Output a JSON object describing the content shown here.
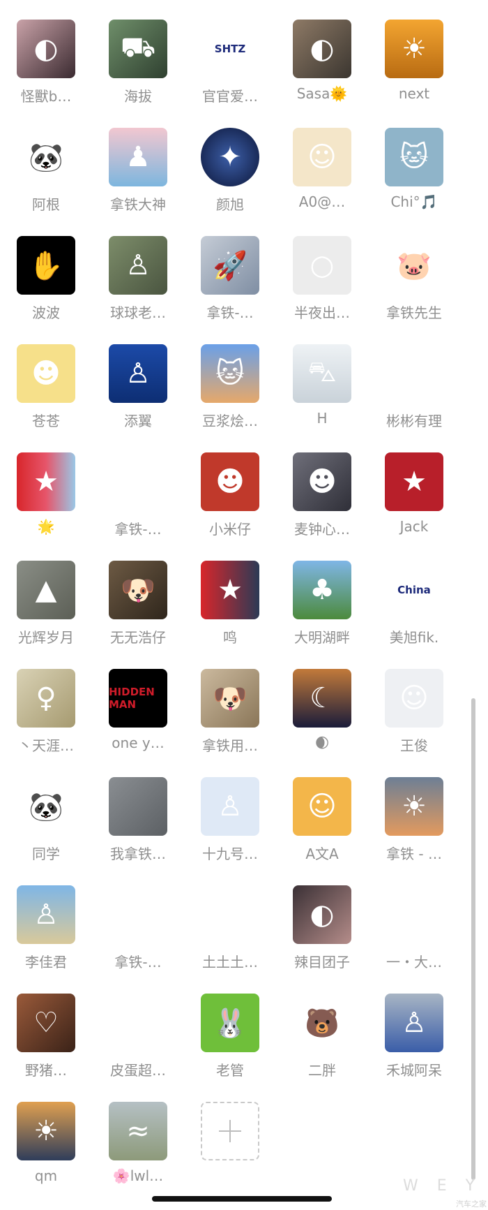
{
  "members": [
    {
      "name": "怪獸b…",
      "icon": "photo-woman-icon",
      "bg": "linear-gradient(135deg,#c9a2a8,#3a2a30)",
      "glyph": "◐"
    },
    {
      "name": "海拔",
      "icon": "photo-car-icon",
      "bg": "linear-gradient(135deg,#6f8f6a,#2f4030)",
      "glyph": "⛟"
    },
    {
      "name": "官官爱…",
      "icon": "shtz-logo-icon",
      "bg": "#ffffff",
      "glyph": "SHTZ"
    },
    {
      "name": "Sasa🌞",
      "icon": "photo-woman-car-icon",
      "bg": "linear-gradient(135deg,#8e7a66,#3b3630)",
      "glyph": "◐"
    },
    {
      "name": "next",
      "icon": "sunset-field-icon",
      "bg": "linear-gradient(180deg,#f3a531,#b86b12)",
      "glyph": "☀"
    },
    {
      "name": "阿根",
      "icon": "panda-icon",
      "bg": "#ffffff",
      "glyph": "🐼"
    },
    {
      "name": "拿铁大神",
      "icon": "swing-silhouette-icon",
      "bg": "linear-gradient(180deg,#f2c7d0,#7db6de)",
      "glyph": "♟"
    },
    {
      "name": "颜旭",
      "icon": "earth-angel-icon",
      "bg": "radial-gradient(circle,#3d5fa8,#0b1538)",
      "glyph": "✦",
      "round": true
    },
    {
      "name": "A0@…",
      "icon": "cartoon-girl-icon",
      "bg": "#f4e6c9",
      "glyph": "☺"
    },
    {
      "name": "Chi°🎵",
      "icon": "tom-cat-icon",
      "bg": "#8fb4c9",
      "glyph": "🐱"
    },
    {
      "name": "波波",
      "icon": "hand-heart-icon",
      "bg": "#000000",
      "glyph": "✋"
    },
    {
      "name": "球球老…",
      "icon": "photo-family-icon",
      "bg": "linear-gradient(135deg,#7d8d6a,#4a5540)",
      "glyph": "♙"
    },
    {
      "name": "拿铁-…",
      "icon": "rocket-icon",
      "bg": "linear-gradient(135deg,#c5ccd6,#7f8ea3)",
      "glyph": "🚀"
    },
    {
      "name": "半夜出…",
      "icon": "whistle-icon",
      "bg": "#ececec",
      "glyph": "○"
    },
    {
      "name": "拿铁先生",
      "icon": "pig-icon",
      "bg": "#ffffff",
      "glyph": "🐷"
    },
    {
      "name": "苍苍",
      "icon": "crayon-shinchan-icon",
      "bg": "#f6e08a",
      "glyph": "☻"
    },
    {
      "name": "添翼",
      "icon": "photo-man-suit-icon",
      "bg": "linear-gradient(180deg,#1c4aa8,#0d2e73)",
      "glyph": "♙"
    },
    {
      "name": "豆浆烩…",
      "icon": "cat-photo-icon",
      "bg": "linear-gradient(180deg,#6aa0e8,#e6a86a)",
      "glyph": "🐱"
    },
    {
      "name": "H",
      "icon": "robot-cars-icon",
      "bg": "linear-gradient(180deg,#eef2f5,#c9d2d9)",
      "glyph": "⛍"
    },
    {
      "name": "彬彬有理",
      "icon": "blank-avatar-icon",
      "bg": "#ffffff",
      "glyph": ""
    },
    {
      "name": "🌟",
      "icon": "flag-anniversary-icon",
      "bg": "linear-gradient(90deg,#d8262b,#e6556a,#9ac7e6)",
      "glyph": "★"
    },
    {
      "name": "拿铁-…",
      "icon": "purple-bunny-icon",
      "bg": "#ffffff",
      "glyph": "😈"
    },
    {
      "name": "小米仔",
      "icon": "luffy-icon",
      "bg": "#c0392b",
      "glyph": "☻"
    },
    {
      "name": "麦钟心…",
      "icon": "photo-man-mask-icon",
      "bg": "linear-gradient(135deg,#6f6f7a,#2f2f38)",
      "glyph": "☻"
    },
    {
      "name": "Jack",
      "icon": "nezha-flag-icon",
      "bg": "#b81f2a",
      "glyph": "★"
    },
    {
      "name": "光辉岁月",
      "icon": "photo-rock-icon",
      "bg": "linear-gradient(135deg,#8a8e86,#5c5f56)",
      "glyph": "▲"
    },
    {
      "name": "无无浩仔",
      "icon": "white-dog-icon",
      "bg": "linear-gradient(135deg,#6d5a44,#2f261c)",
      "glyph": "🐶"
    },
    {
      "name": "鸣",
      "icon": "flag-anime-boy-icon",
      "bg": "linear-gradient(90deg,#d8262b,#2c3a55)",
      "glyph": "★"
    },
    {
      "name": "大明湖畔",
      "icon": "palm-tree-icon",
      "bg": "linear-gradient(180deg,#7fb6e6,#4c8a3c)",
      "glyph": "♣"
    },
    {
      "name": "美旭fik.",
      "icon": "china-eye-icon",
      "bg": "#ffffff",
      "glyph": "China"
    },
    {
      "name": "丶天涯…",
      "icon": "photo-twins-icon",
      "bg": "linear-gradient(135deg,#d9d2b5,#a69a70)",
      "glyph": "♀"
    },
    {
      "name": "one y…",
      "icon": "hidden-man-icon",
      "bg": "#000000",
      "glyph": "HIDDEN MAN"
    },
    {
      "name": "拿铁用…",
      "icon": "dog-photo-icon",
      "bg": "linear-gradient(135deg,#cbb99e,#8a7658)",
      "glyph": "🐶"
    },
    {
      "name": "🌒",
      "icon": "dusk-silhouette-icon",
      "bg": "linear-gradient(180deg,#c27a3a,#1a1c3a)",
      "glyph": "☾"
    },
    {
      "name": "王俊",
      "icon": "cartoon-boy-icon",
      "bg": "#eef0f3",
      "glyph": "☺"
    },
    {
      "name": "同学",
      "icon": "panda-small-icon",
      "bg": "#ffffff",
      "glyph": "🐼"
    },
    {
      "name": "我拿铁…",
      "icon": "gray-photo-icon",
      "bg": "linear-gradient(135deg,#8a8e92,#5c6064)",
      "glyph": ""
    },
    {
      "name": "十九号…",
      "icon": "police-cartoon-icon",
      "bg": "#dfe9f6",
      "glyph": "♙"
    },
    {
      "name": "A文A",
      "icon": "monk-cartoon-icon",
      "bg": "#f3b64a",
      "glyph": "☺"
    },
    {
      "name": "拿铁 - …",
      "icon": "sunset-sky-icon",
      "bg": "linear-gradient(180deg,#6d7f95,#e39a5e)",
      "glyph": "☀"
    },
    {
      "name": "李佳君",
      "icon": "photo-family-beach-icon",
      "bg": "linear-gradient(180deg,#7fb6e6,#d9c99a)",
      "glyph": "♙"
    },
    {
      "name": "拿铁-…",
      "icon": "heart-sketch-icon",
      "bg": "#ffffff",
      "glyph": "♥"
    },
    {
      "name": "土土土…",
      "icon": "heart-sketch-icon",
      "bg": "#ffffff",
      "glyph": "♥"
    },
    {
      "name": "辣目团子",
      "icon": "photo-woman-portrait-icon",
      "bg": "linear-gradient(135deg,#3a3035,#b58d8a)",
      "glyph": "◐"
    },
    {
      "name": "一・大…",
      "icon": "cartoon-sitting-icon",
      "bg": "#ffffff",
      "glyph": "☺"
    },
    {
      "name": "野猪…",
      "icon": "hands-heart-icon",
      "bg": "linear-gradient(135deg,#9a5a3a,#3a2218)",
      "glyph": "♡"
    },
    {
      "name": "皮蛋超…",
      "icon": "baby-photo-icon",
      "bg": "#ffffff",
      "glyph": "☺"
    },
    {
      "name": "老管",
      "icon": "bunny-glasses-icon",
      "bg": "#6fbf3a",
      "glyph": "🐰"
    },
    {
      "name": "二胖",
      "icon": "bear-cake-icon",
      "bg": "#ffffff",
      "glyph": "🐻"
    },
    {
      "name": "禾城阿呆",
      "icon": "photo-man-mountain-icon",
      "bg": "linear-gradient(180deg,#a8b5c4,#3a5da8)",
      "glyph": "♙"
    },
    {
      "name": "qm",
      "icon": "sunset-lake-icon",
      "bg": "linear-gradient(180deg,#e0a050,#2f3d5a)",
      "glyph": "☀"
    },
    {
      "name": "🌸lwl…",
      "icon": "lake-reeds-icon",
      "bg": "linear-gradient(180deg,#b5c0c4,#8d9a7a)",
      "glyph": "≈"
    }
  ],
  "add_button": {
    "label": "+"
  },
  "watermark": {
    "text": "W E Y",
    "small": "汽车之家"
  }
}
